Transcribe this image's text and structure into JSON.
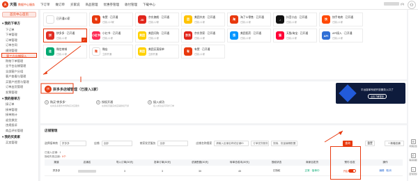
{
  "header": {
    "brand_logo": "天",
    "brand_name": "天猫",
    "brand_sub": "数据中心服务",
    "nav": [
      "下订单",
      "做订单",
      "买家说",
      "商品管理",
      "优惠券管理",
      "收付管理",
      "下载中心"
    ],
    "user_id": "(0)",
    "avatar_icon": "user-icon"
  },
  "sidebar": {
    "home_button": "首页中心首页",
    "groups": [
      {
        "title": "▾ 我的下单方",
        "items": [
          "下订单",
          "下单管理",
          "订单管理",
          "订单合同",
          "规则管理",
          "第三方店铺接入",
          "购物下单管理",
          "全平台店铺管理",
          "全部客户分组",
          "客户查看与管理",
          "买客户经营与管理",
          "订单出货管理",
          "发票管理"
        ],
        "active_index": 5
      },
      {
        "title": "▾ 我的接单方",
        "items": [
          "接订单",
          "接单管理",
          "接单统计",
          "退货换货",
          "违规投诉",
          "商品评价管理"
        ]
      },
      {
        "title": "▾ 我的买卖家",
        "items": [
          "买卖管理"
        ]
      }
    ]
  },
  "cards": [
    {
      "name": "card-a",
      "icon_text": "",
      "color": "#ffffff",
      "title": "已开通10家",
      "sub": ""
    },
    {
      "name": "card-youzan",
      "icon_text": "有",
      "color": "#e8380d",
      "title": "有赞 · 已开通",
      "sub": "已接入10家"
    },
    {
      "name": "card-jd",
      "icon_text": "JD",
      "color": "#e1251b",
      "title": "京东旗舰 · 已开通",
      "sub": "已接入2家"
    },
    {
      "name": "card-meituan",
      "icon_text": "团",
      "color": "#ffc300",
      "title": "美团外卖 · 已开通",
      "sub": "已接入1家"
    },
    {
      "name": "card-taobao",
      "icon_text": "淘",
      "color": "#e8380d",
      "title": "淘了么零售 · 已开通",
      "sub": "已接入1家"
    },
    {
      "name": "card-tiktok",
      "icon_text": "♪",
      "color": "#111111",
      "title": "抖音小店 · 已开通",
      "sub": "已接入1家"
    },
    {
      "name": "card-kuaishou",
      "icon_text": "快",
      "color": "#ff4906",
      "title": "快手电商 · 已开通",
      "sub": "已接入1家"
    },
    {
      "name": "card-pdd",
      "icon_text": "拼",
      "color": "#e02e24",
      "title": "拼多多 · 已开通",
      "sub": "已接入1家",
      "selected": true
    },
    {
      "name": "card-xiaohongshu",
      "icon_text": "小红书",
      "color": "#fe2c55",
      "title": "小红书 · 已开通",
      "sub": "已接入1家"
    },
    {
      "name": "card-meituan2",
      "icon_text": "美团",
      "color": "#ffd100",
      "title": "美团闪购 · 已开通",
      "sub": "已接入1家"
    },
    {
      "name": "card-jdhome",
      "icon_text": "京东",
      "color": "#e1251b",
      "title": "京东到家 · 已开通",
      "sub": "已接入1家"
    },
    {
      "name": "card-ele",
      "icon_text": "饿",
      "color": "#0095ff",
      "title": "美团医药 · 已开通",
      "sub": "已接入1家"
    },
    {
      "name": "card-tmall",
      "icon_text": "猫",
      "color": "#ff0036",
      "title": "天猫/淘宝 · 已开通",
      "sub": "已接入1家"
    },
    {
      "name": "card-api",
      "icon_text": "API",
      "color": "#2f6fd6",
      "title": "API接入 · 已开通",
      "sub": "已接入1家"
    },
    {
      "name": "card-lianlian",
      "icon_text": "连",
      "color": "#00a870",
      "title": "微信商城",
      "sub": "已接入1家"
    },
    {
      "name": "card-weidian",
      "icon_text": "微",
      "color": "#ffffff",
      "title": "微店",
      "sub": "立即开通"
    },
    {
      "name": "card-meituan3",
      "icon_text": "美团",
      "color": "#ffd100",
      "title": "美团买菜接单",
      "sub": "立即开通"
    },
    {
      "name": "card-youzan2",
      "icon_text": "有",
      "color": "#e8380d",
      "title": "有赞 · 已开通",
      "sub": "已接入1家"
    }
  ],
  "store": {
    "logo": "拼",
    "title": "拼多多店铺管理（已接入1家）",
    "steps": [
      {
        "num": "1",
        "title": "购买\"拼多多\"",
        "desc": "在拼多多服务市场购买对应服务"
      },
      {
        "num": "2",
        "title": "授权开通",
        "desc": "在授权页面完成店铺授权开通"
      },
      {
        "num": "3",
        "title": "接入成功",
        "desc": "接入成功后可同步订单"
      }
    ],
    "banner_text": "平台接单系统开放服务入口了",
    "banner_button": "点击了解更多"
  },
  "mgmt": {
    "title": "店铺管理",
    "filters": [
      {
        "label": "选择接单商",
        "value": "拼多多"
      },
      {
        "label": "店铺",
        "value": "全部"
      },
      {
        "label": "商家发货服务",
        "value": "全部"
      },
      {
        "label": "店铺名称搜索",
        "value": "请输入店铺名称或店铺ID"
      },
      {
        "label": "",
        "value": "订单发货服务"
      },
      {
        "label": "",
        "value": "搜索、批量编辑配置"
      }
    ],
    "query_label": "查询",
    "reset_label": "重置",
    "add_label": "+ 新增店铺",
    "auth_info": "已接入店铺：1",
    "err_prefix": "授权失败店铺：",
    "err_count": "0个",
    "columns": [
      "渠道",
      "店铺名",
      "导入订单(30天)",
      "发单订单(30天)",
      "总销售额(30天)",
      "转单总成本(30天)",
      "授权状态",
      "商家自发货",
      "预付/自发",
      "操作"
    ],
    "row": {
      "channel": "拼多多",
      "import_orders": "3",
      "send_orders": "3",
      "sales": "30",
      "cost": "45",
      "auth_status": "已授权",
      "self_ship": "正常 · 接单中",
      "toggle_label": "开启",
      "actions": [
        "编辑",
        "取消"
      ]
    }
  },
  "rightbar": [
    {
      "icon": "☰",
      "label": "问题反馈"
    },
    {
      "icon": "✆",
      "label": "联系客服"
    },
    {
      "icon": "⌂",
      "label": "回到顶部"
    }
  ]
}
